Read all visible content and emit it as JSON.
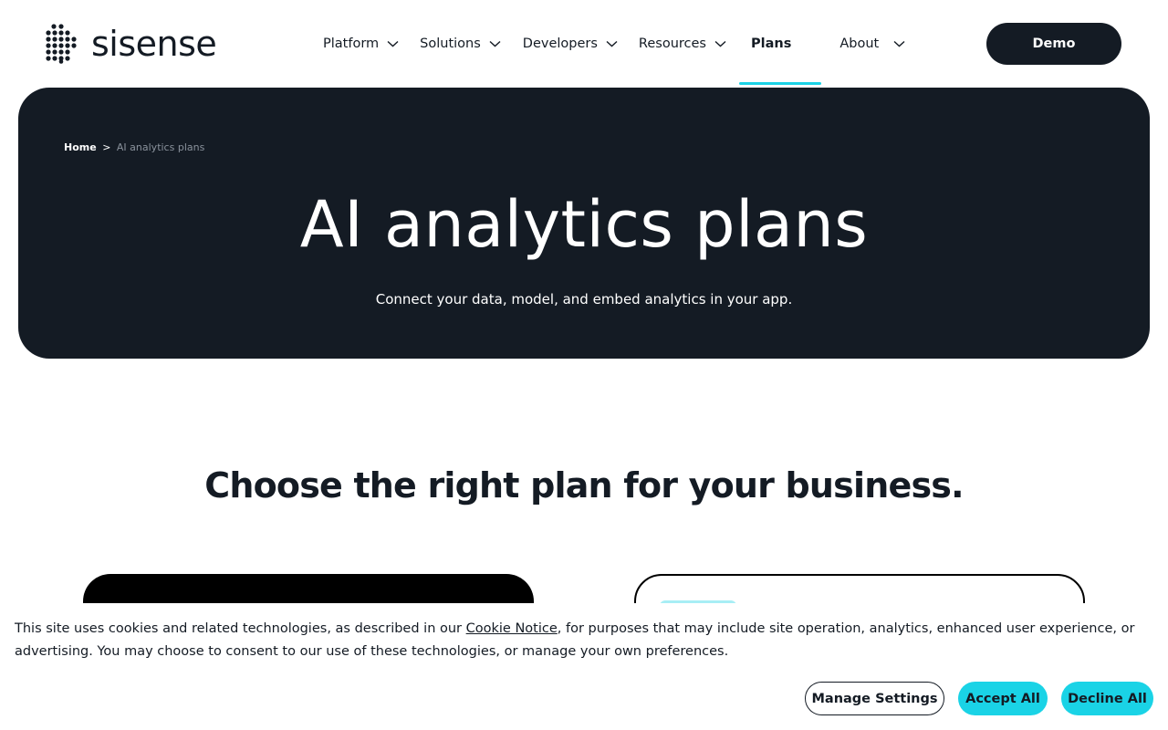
{
  "brand": {
    "name": "sisense",
    "logo_icon": "sisense-dots-logo"
  },
  "nav": {
    "items": [
      {
        "label": "Platform",
        "has_dropdown": true
      },
      {
        "label": "Solutions",
        "has_dropdown": true
      },
      {
        "label": "Developers",
        "has_dropdown": true
      },
      {
        "label": "Resources",
        "has_dropdown": true
      },
      {
        "label": "Plans",
        "has_dropdown": false,
        "active": true
      },
      {
        "label": "About",
        "has_dropdown": true
      }
    ],
    "cta": "Demo"
  },
  "hero": {
    "breadcrumb": {
      "home": "Home",
      "separator": ">",
      "current": "AI analytics plans"
    },
    "title": "AI analytics plans",
    "subtitle": "Connect your data, model, and embed analytics in your app."
  },
  "plans": {
    "heading": "Choose the right plan for your business."
  },
  "cookie_banner": {
    "text_before": "This site uses cookies and related technologies, as described in our ",
    "link_text": "Cookie Notice",
    "text_after": ", for purposes that may include site operation, analytics, enhanced user experience, or advertising. You may choose to consent to our use of these technologies, or manage your own preferences.",
    "manage_label": "Manage Settings",
    "accept_label": "Accept All",
    "decline_label": "Decline All"
  },
  "colors": {
    "dark": "#141b24",
    "accent": "#1ad3e6",
    "black": "#000000"
  }
}
